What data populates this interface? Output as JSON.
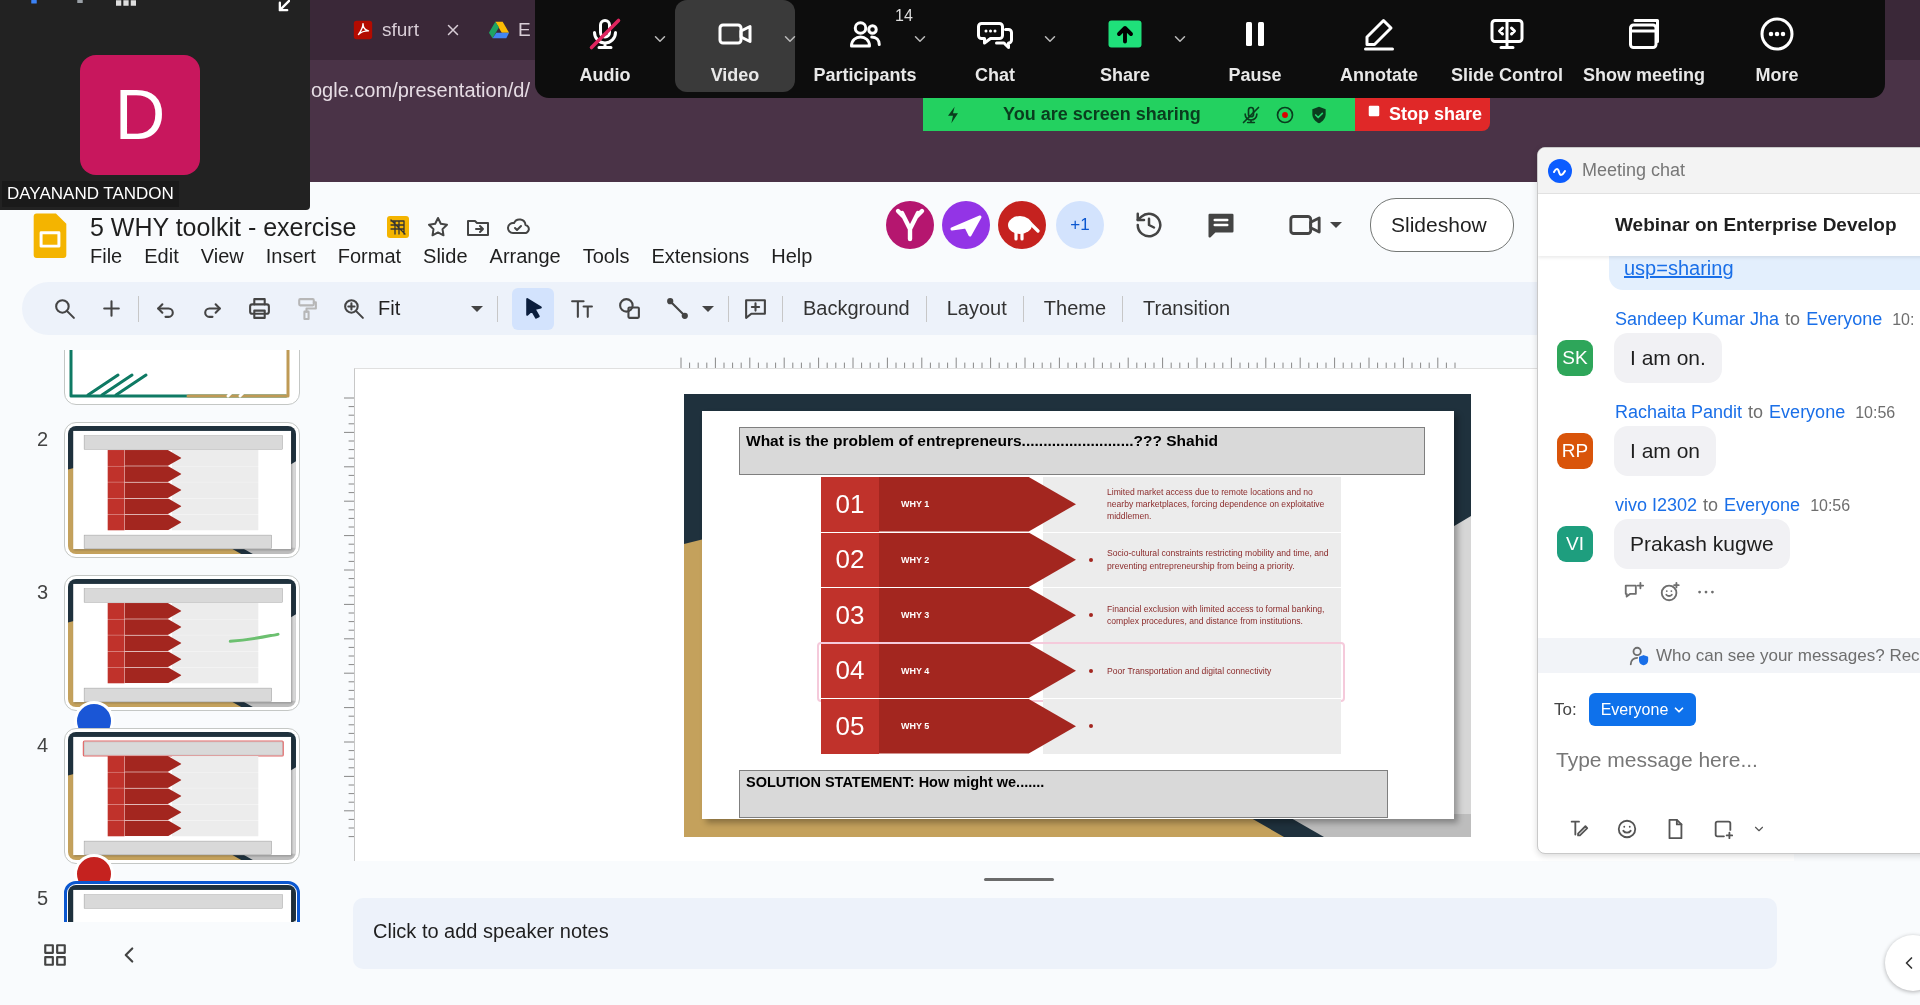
{
  "browser": {
    "tabs": [
      {
        "label": "sfurt",
        "closable": true
      },
      {
        "label": "E",
        "closable": false
      }
    ],
    "address": "ogle.com/presentation/d/"
  },
  "video_tile": {
    "initial": "D",
    "name": "DAYANAND TANDON"
  },
  "meeting_toolbar": {
    "buttons": [
      {
        "kind": "audio",
        "label": "Audio",
        "muted": true,
        "menu": true,
        "selected": false
      },
      {
        "kind": "video",
        "label": "Video",
        "muted": false,
        "menu": true,
        "selected": true
      },
      {
        "kind": "participants",
        "label": "Participants",
        "count": "14",
        "muted": false,
        "menu": true,
        "selected": false
      },
      {
        "kind": "chat",
        "label": "Chat",
        "muted": false,
        "menu": true,
        "selected": false
      },
      {
        "kind": "share",
        "label": "Share",
        "muted": false,
        "menu": true,
        "selected": false
      },
      {
        "kind": "pause",
        "label": "Pause",
        "muted": false,
        "menu": false,
        "selected": false
      },
      {
        "kind": "annotate",
        "label": "Annotate",
        "muted": false,
        "menu": false,
        "selected": false
      },
      {
        "kind": "slide_control",
        "label": "Slide Control",
        "muted": false,
        "menu": false,
        "selected": false
      },
      {
        "kind": "show_meeting",
        "label": "Show meeting",
        "muted": false,
        "menu": false,
        "selected": false
      },
      {
        "kind": "more",
        "label": "More",
        "muted": false,
        "menu": false,
        "selected": false
      }
    ]
  },
  "share_banner": {
    "text": "You are screen sharing",
    "stop_label": "Stop share"
  },
  "document": {
    "title": "5 WHY toolkit - exercise",
    "menu": [
      "File",
      "Edit",
      "View",
      "Insert",
      "Format",
      "Slide",
      "Arrange",
      "Tools",
      "Extensions",
      "Help"
    ],
    "collaborators": [
      {
        "color": "#b5166f"
      },
      {
        "color": "#9334e6"
      },
      {
        "color": "#c5221f"
      }
    ],
    "more_collaborators": "+1",
    "slideshow_label": "Slideshow"
  },
  "toolbar": {
    "edit_tools": [
      {
        "kind": "search",
        "disabled": false
      },
      {
        "kind": "add",
        "disabled": false
      },
      {
        "kind": "undo",
        "disabled": false
      },
      {
        "kind": "redo",
        "disabled": false
      },
      {
        "kind": "print",
        "disabled": false
      },
      {
        "kind": "paint_format",
        "disabled": true
      },
      {
        "kind": "zoom",
        "disabled": false
      }
    ],
    "zoom": "Fit",
    "tools": [
      {
        "kind": "select",
        "selected": true
      },
      {
        "kind": "text",
        "selected": false
      },
      {
        "kind": "shape",
        "selected": false
      },
      {
        "kind": "line",
        "selected": false
      }
    ],
    "actions": [
      "Background",
      "Layout",
      "Theme",
      "Transition"
    ]
  },
  "filmstrip": [
    {
      "kind": "cover",
      "selected": false
    },
    {
      "kind": "why",
      "number": "2",
      "selected": false,
      "title_highlighted": false,
      "ink": false
    },
    {
      "kind": "why",
      "number": "3",
      "selected": false,
      "title_highlighted": false,
      "ink": true,
      "color": "#1a56d6"
    },
    {
      "kind": "why",
      "number": "4",
      "selected": false,
      "title_highlighted": true,
      "ink": false,
      "color": "#c5221f"
    },
    {
      "kind": "why_top",
      "number": "5",
      "selected": true
    }
  ],
  "slide": {
    "title": "What is the problem of entrepreneurs..........................??? Shahid",
    "solution": "SOLUTION STATEMENT: How might we.......",
    "rows": [
      {
        "number": "01",
        "label": "WHY 1",
        "bullet": false,
        "selected": false,
        "text": "Limited market access due to remote locations and no nearby marketplaces, forcing dependence on exploitative middlemen."
      },
      {
        "number": "02",
        "label": "WHY 2",
        "bullet": true,
        "selected": false,
        "text": "Socio-cultural constraints restricting mobility and time, and preventing entrepreneurship from being a priority."
      },
      {
        "number": "03",
        "label": "WHY 3",
        "bullet": true,
        "selected": false,
        "text": "Financial exclusion with limited access to formal banking, complex procedures, and distance from institutions."
      },
      {
        "number": "04",
        "label": "WHY 4",
        "bullet": true,
        "selected": true,
        "text": "Poor Transportation and digital connectivity"
      },
      {
        "number": "05",
        "label": "WHY 5",
        "bullet": true,
        "selected": false
      }
    ]
  },
  "speaker_notes": {
    "placeholder": "Click to add speaker notes"
  },
  "chat": {
    "header": "Meeting chat",
    "title": "Webinar on Enterprise Develop",
    "link_fragment": "usp=sharing",
    "messages": [
      {
        "initials": "SK",
        "color": "#2ea65a",
        "sender": "Sandeep Kumar Jha",
        "to_word": "to",
        "recipient": "Everyone",
        "time": "10:",
        "text": "I am on."
      },
      {
        "initials": "RP",
        "color": "#d9540a",
        "sender": "Rachaita Pandit",
        "to_word": "to",
        "recipient": "Everyone",
        "time": "10:56",
        "text": "I am on"
      },
      {
        "initials": "VI",
        "color": "#1e9e7e",
        "sender": "vivo I2302",
        "to_word": "to",
        "recipient": "Everyone",
        "time": "10:56",
        "text": "Prakash kugwe"
      }
    ],
    "privacy_note": "Who can see your messages? Rec",
    "to_label": "To:",
    "recipient": "Everyone",
    "placeholder": "Type message here..."
  }
}
